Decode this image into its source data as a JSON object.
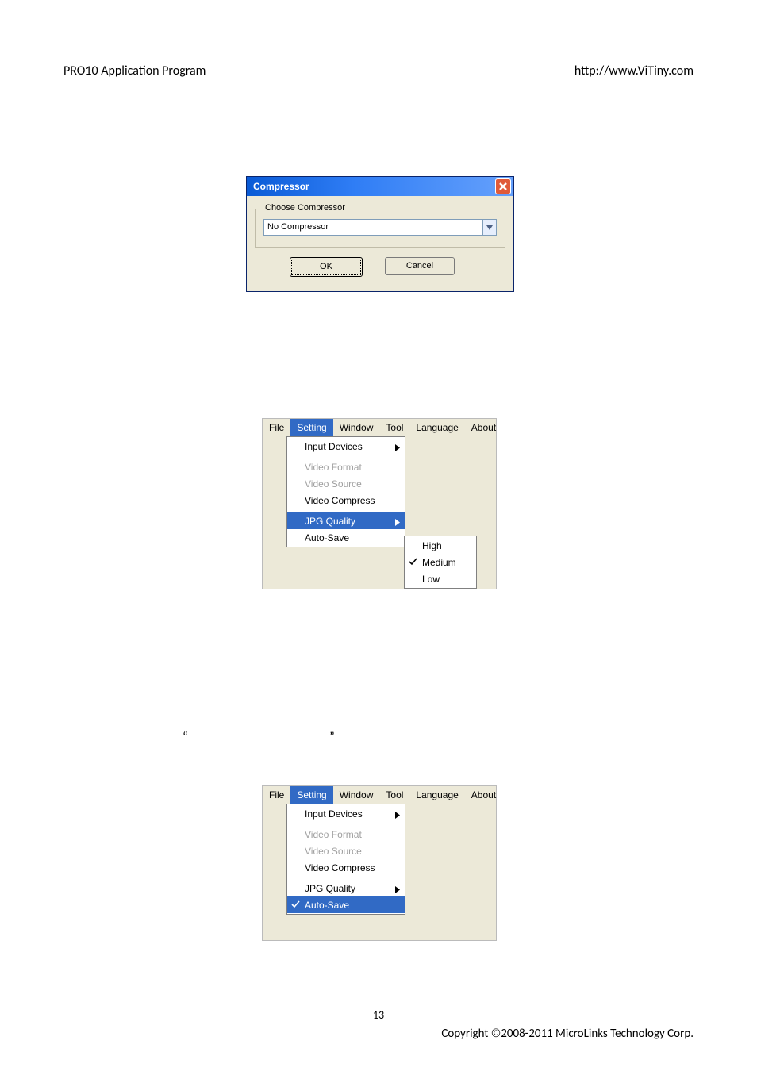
{
  "header": {
    "left": "PRO10 Application Program",
    "right": "http://www.ViTiny.com"
  },
  "dialog": {
    "title": "Compressor",
    "group_label": "Choose Compressor",
    "combo_value": "No Compressor",
    "ok_label": "OK",
    "cancel_label": "Cancel"
  },
  "menubar": {
    "items": [
      "File",
      "Setting",
      "Window",
      "Tool",
      "Language",
      "About"
    ]
  },
  "dropdown": {
    "items": [
      {
        "label": "Input Devices",
        "sub": true
      },
      "sep",
      {
        "label": "Video Format",
        "disabled": true
      },
      {
        "label": "Video Source",
        "disabled": true
      },
      {
        "label": "Video Compress"
      },
      "sep",
      {
        "label": "JPG Quality",
        "sub": true
      },
      {
        "label": "Auto-Save"
      }
    ]
  },
  "submenu1_items": [
    {
      "label": "High"
    },
    {
      "label": "Medium",
      "checked": true
    },
    {
      "label": "Low"
    }
  ],
  "quotes": {
    "open": "“",
    "close": "”"
  },
  "footer": {
    "page": "13",
    "copyright": "Copyright ©2008-2011 MicroLinks Technology Corp."
  }
}
